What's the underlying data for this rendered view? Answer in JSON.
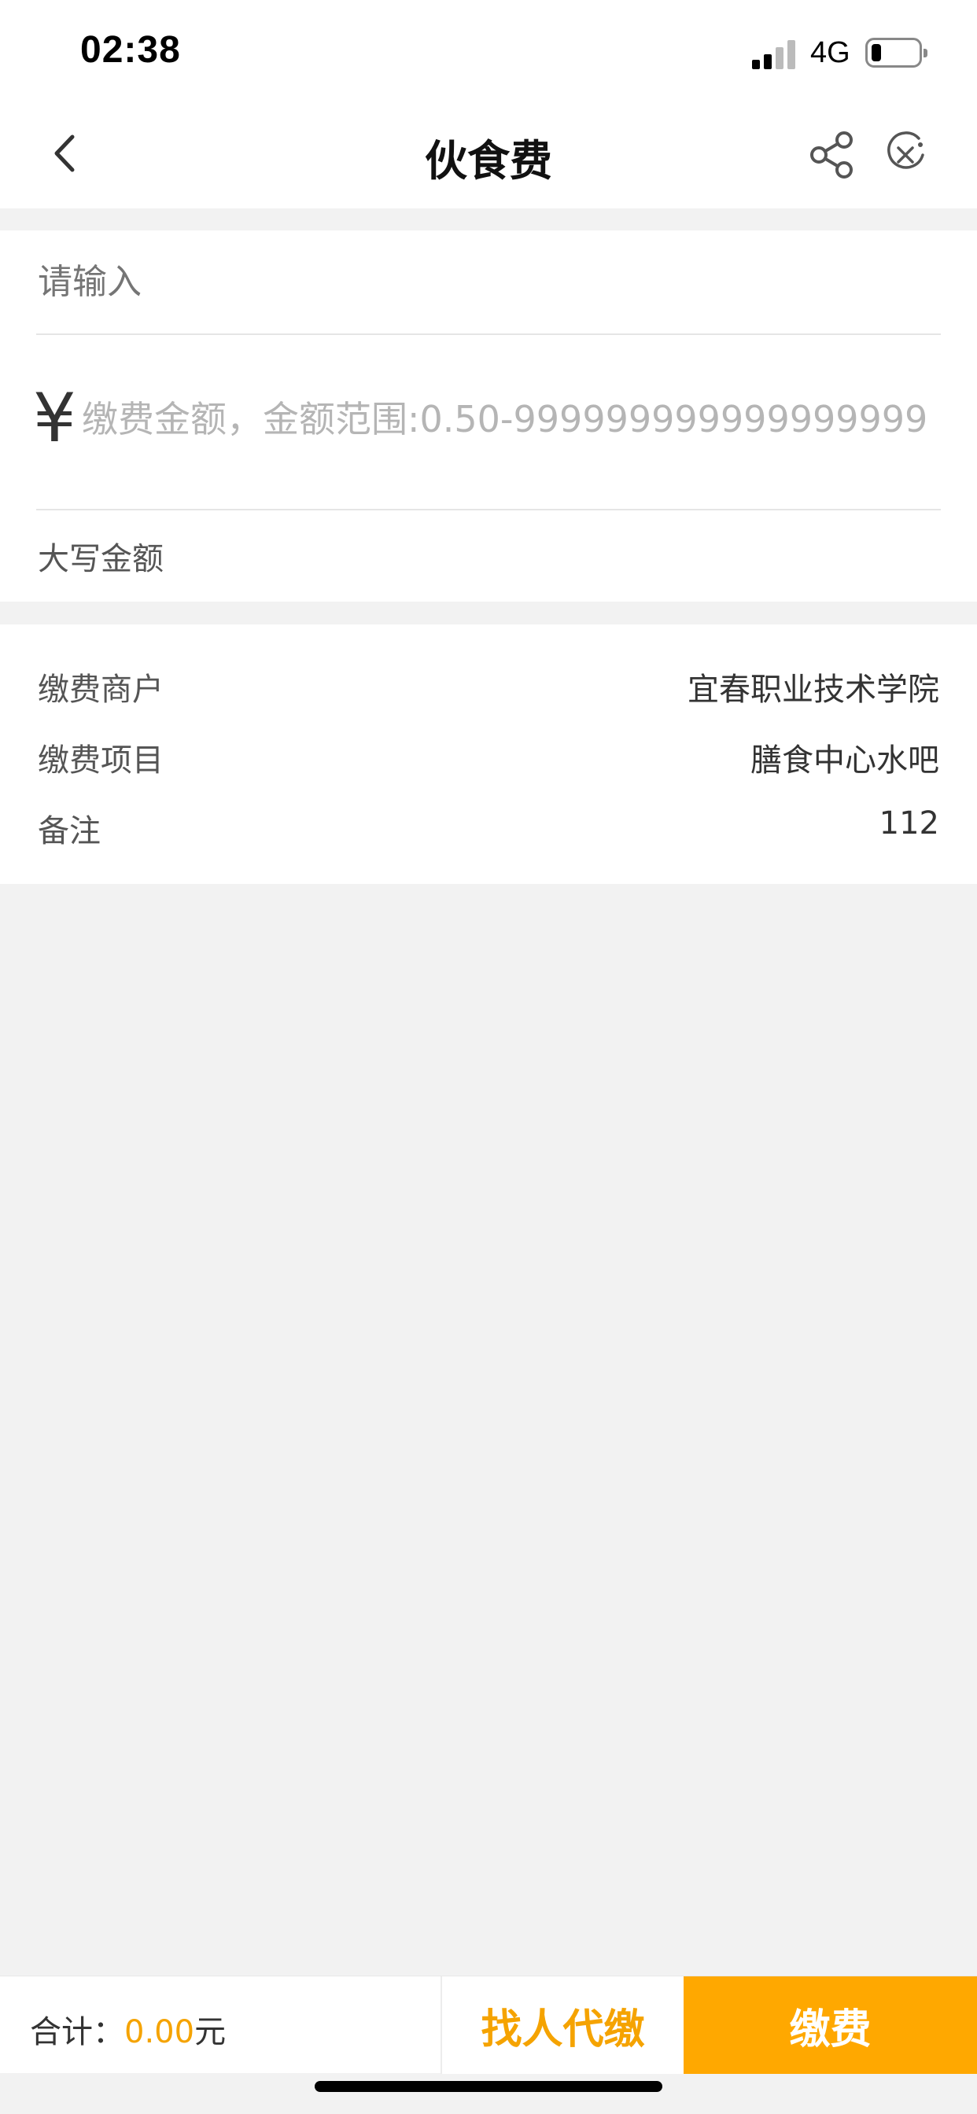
{
  "status_bar": {
    "time": "02:38",
    "network": "4G",
    "battery_level": 0.2
  },
  "nav": {
    "title": "伙食费",
    "icons": [
      "chevron-left-icon",
      "share-icon",
      "close-circle-icon"
    ]
  },
  "form": {
    "payer_placeholder": "请输入",
    "currency_symbol": "¥",
    "amount_placeholder": "缴费金额，金额范围:0.50-999999999999999999",
    "uppercase_label": "大写金额"
  },
  "info": {
    "rows": [
      {
        "label": "缴费商户",
        "value": "宜春职业技术学院"
      },
      {
        "label": "缴费项目",
        "value": "膳食中心水吧"
      },
      {
        "label": "备注",
        "value": "112"
      }
    ]
  },
  "footer": {
    "total_label": "合计：",
    "total_amount": "0.00",
    "total_unit": "元",
    "proxy_button": "找人代缴",
    "pay_button": "缴费"
  },
  "colors": {
    "accent": "#ffa800",
    "accent_text": "#f5a300",
    "background": "#f2f2f2"
  }
}
